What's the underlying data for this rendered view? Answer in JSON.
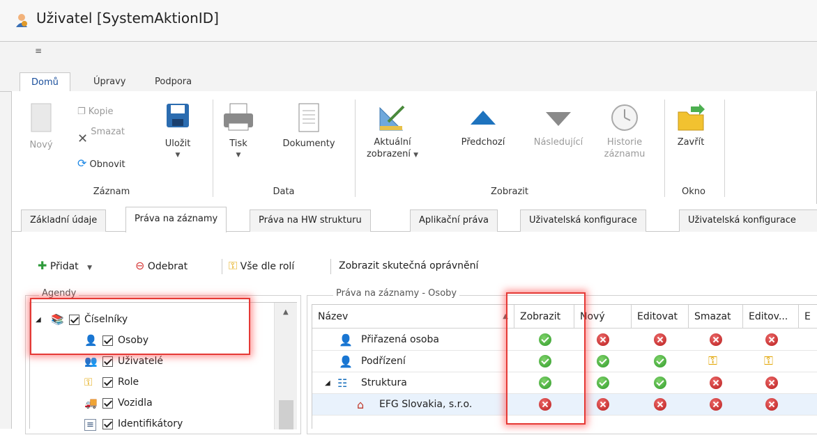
{
  "window": {
    "title": "Uživatel [SystemAktionID]"
  },
  "qat": {
    "customize_glyph": "₹"
  },
  "ribbon_tabs": [
    {
      "label": "Domů",
      "active": true
    },
    {
      "label": "Úpravy",
      "active": false
    },
    {
      "label": "Podpora",
      "active": false
    }
  ],
  "ribbon": {
    "zaznam": {
      "novy": "Nový",
      "kopie": "Kopie",
      "smazat": "Smazat",
      "obnovit": "Obnovit",
      "ulozit": "Uložit",
      "group": "Záznam"
    },
    "data": {
      "tisk": "Tisk",
      "dokumenty": "Dokumenty",
      "group": "Data"
    },
    "zobrazit": {
      "aktualni_1": "Aktuální",
      "aktualni_2": "zobrazení",
      "predchozi": "Předchozí",
      "nasledujici": "Následující",
      "historie_1": "Historie",
      "historie_2": "záznamu",
      "group": "Zobrazit"
    },
    "okno": {
      "zavrit": "Zavřít",
      "group": "Okno"
    }
  },
  "page_tabs": [
    {
      "label": "Základní údaje",
      "active": false
    },
    {
      "label": "Práva na záznamy",
      "active": true
    },
    {
      "label": "Práva na HW strukturu",
      "active": false
    },
    {
      "label": "Aplikační práva",
      "active": false
    },
    {
      "label": "Uživatelská konfigurace",
      "active": false
    },
    {
      "label": "Uživatelská konfigurace",
      "active": false
    }
  ],
  "toolbar": {
    "pridat": "Přidat",
    "odebrat": "Odebrat",
    "vse_dle_roli": "Vše dle rolí",
    "zobrazit_skutecna": "Zobrazit skutečná oprávnění"
  },
  "agendy": {
    "legend": "Agendy",
    "items": [
      {
        "label": "Číselníky",
        "checked": true,
        "icon": "books-icon"
      },
      {
        "label": "Osoby",
        "checked": true,
        "icon": "person-icon"
      },
      {
        "label": "Uživatelé",
        "checked": true,
        "icon": "users-icon"
      },
      {
        "label": "Role",
        "checked": true,
        "icon": "key-shield-icon"
      },
      {
        "label": "Vozidla",
        "checked": true,
        "icon": "truck-icon"
      },
      {
        "label": "Identifikátory",
        "checked": true,
        "icon": "id-card-icon"
      }
    ]
  },
  "prava": {
    "legend": "Práva na záznamy - Osoby",
    "columns": [
      "Název",
      "Zobrazit",
      "Nový",
      "Editovat",
      "Smazat",
      "Editov...",
      "E"
    ],
    "rows": [
      {
        "name": "Přiřazená osoba",
        "values": [
          "ok",
          "no",
          "no",
          "no",
          "no"
        ]
      },
      {
        "name": "Podřízení",
        "values": [
          "ok",
          "ok",
          "ok",
          "key",
          "key"
        ]
      },
      {
        "name": "Struktura",
        "values": [
          "ok",
          "ok",
          "ok",
          "no",
          "no"
        ]
      },
      {
        "name": "EFG Slovakia, s.r.o.",
        "values": [
          "no",
          "no",
          "no",
          "no",
          "no"
        ]
      }
    ]
  },
  "colors": {
    "accent": "#1a4f9c",
    "highlight": "#e53935",
    "ok": "#2f9a2a",
    "deny": "#b71c1c"
  }
}
